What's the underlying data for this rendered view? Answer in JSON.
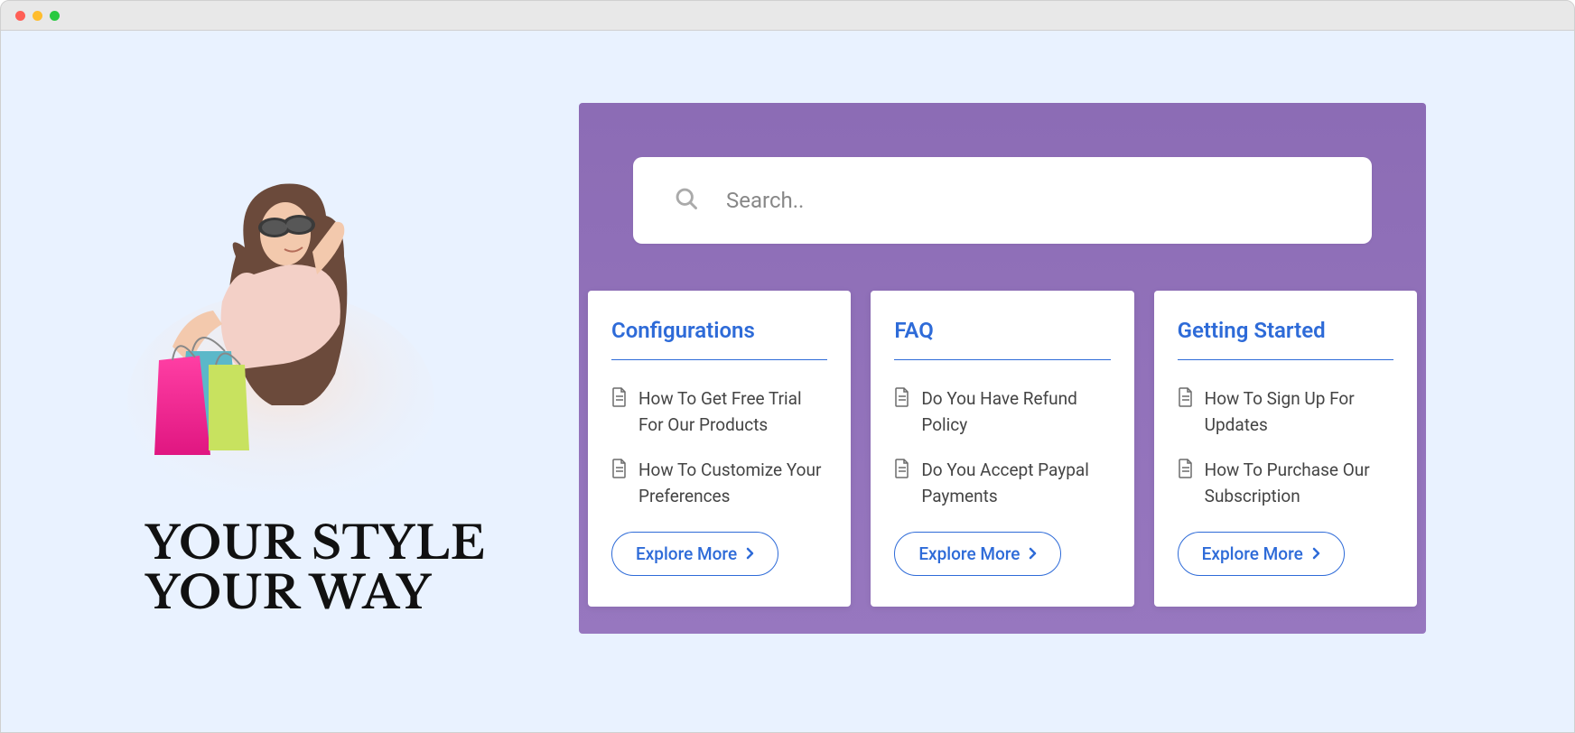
{
  "search": {
    "placeholder": "Search.."
  },
  "headline": {
    "line1": "YOUR STYLE",
    "line2": "YOUR WAY"
  },
  "explore_label": "Explore More",
  "cards": [
    {
      "title": "Configurations",
      "items": [
        "How To Get Free Trial For Our Products",
        "How To Customize Your Preferences"
      ]
    },
    {
      "title": "FAQ",
      "items": [
        "Do You Have Refund Policy",
        "Do You Accept Paypal Payments"
      ]
    },
    {
      "title": "Getting Started",
      "items": [
        "How To Sign Up For Updates",
        "How To Purchase Our Subscription"
      ]
    }
  ],
  "colors": {
    "accent": "#2e6bd8",
    "panel": "#8c6cb5"
  }
}
